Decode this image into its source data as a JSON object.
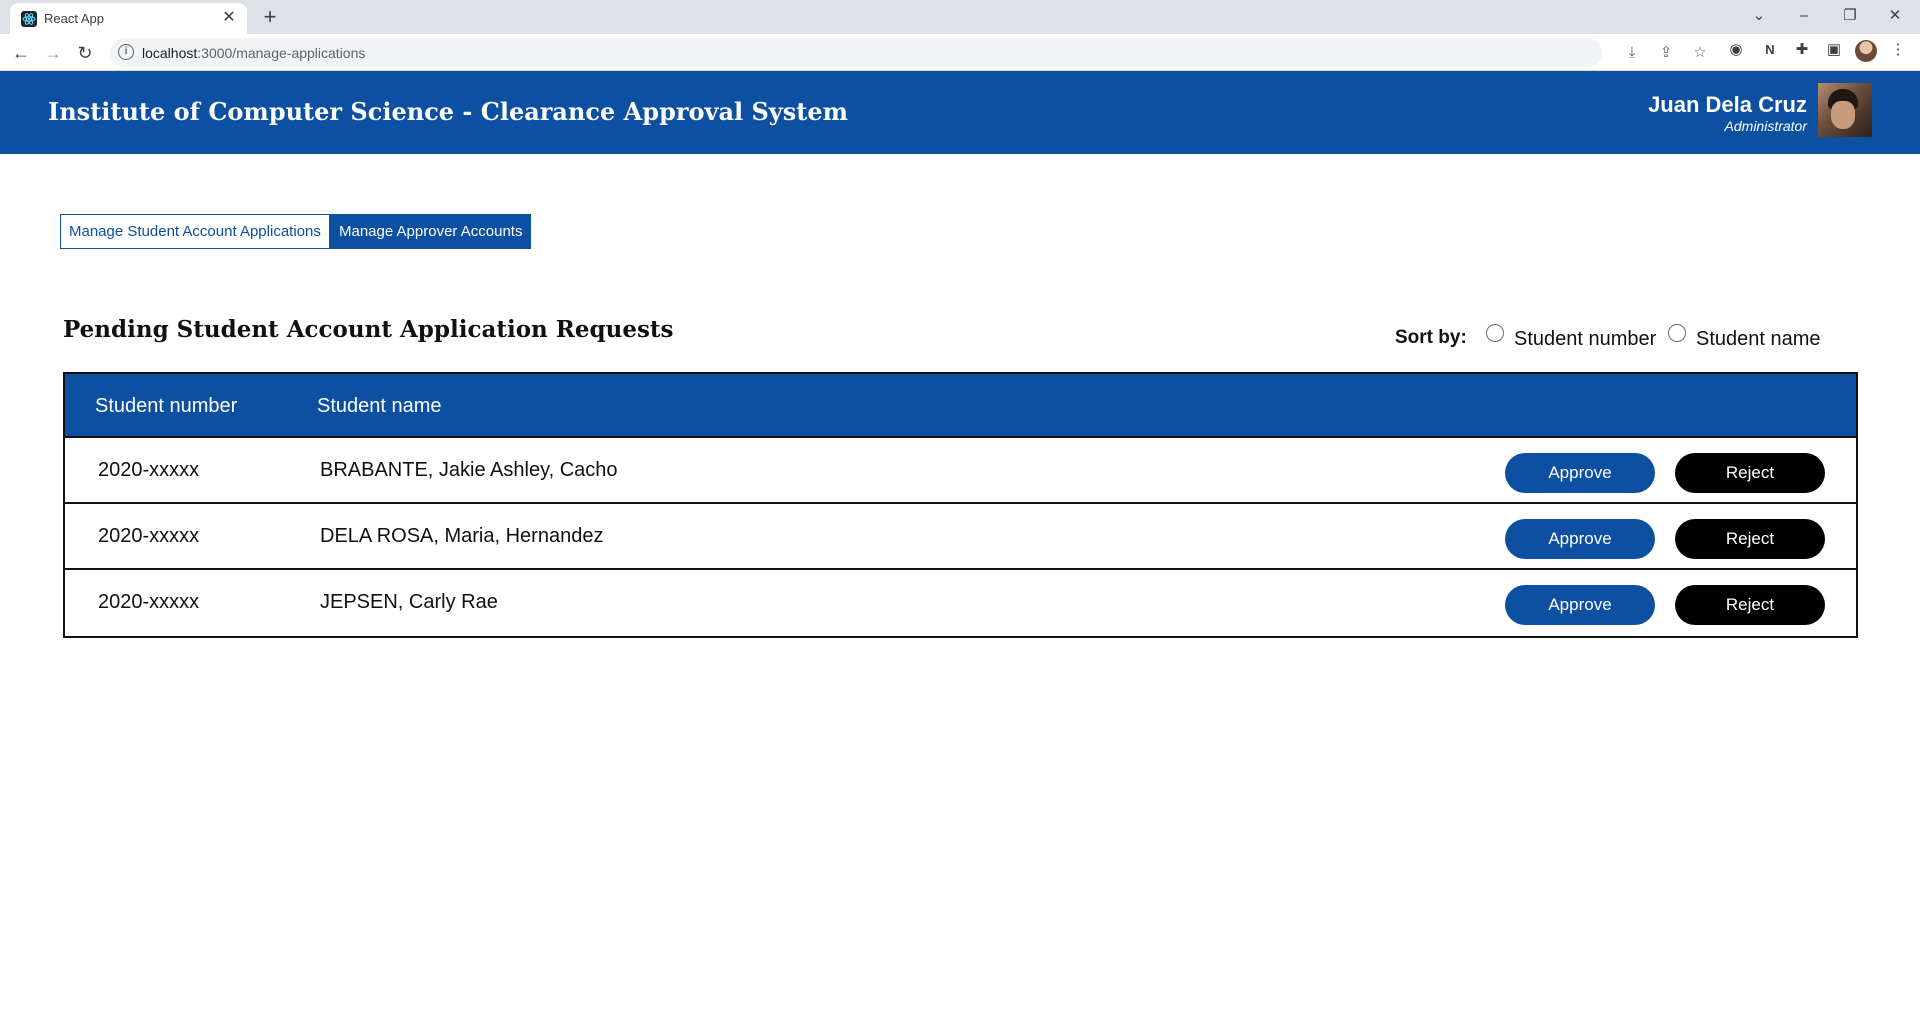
{
  "browser": {
    "tab_title": "React App",
    "tab_close": "✕",
    "new_tab": "+",
    "url_host": "localhost",
    "url_path": ":3000/manage-applications"
  },
  "header": {
    "title": "Institute of Computer Science - Clearance Approval System",
    "user_name": "Juan Dela Cruz",
    "user_role": "Administrator"
  },
  "nav": {
    "student_apps_label": "Manage Student Account Applications",
    "approver_accounts_label": "Manage Approver Accounts"
  },
  "section": {
    "title": "Pending Student Account Application Requests",
    "sort_label": "Sort by:",
    "sort_options": [
      "Student number",
      "Student name"
    ]
  },
  "table": {
    "headers": [
      "Student number",
      "Student name"
    ],
    "rows": [
      {
        "student_number": "2020-xxxxx",
        "student_name": "BRABANTE, Jakie Ashley, Cacho"
      },
      {
        "student_number": "2020-xxxxx",
        "student_name": "DELA ROSA, Maria, Hernandez"
      },
      {
        "student_number": "2020-xxxxx",
        "student_name": "JEPSEN, Carly Rae"
      }
    ],
    "approve_label": "Approve",
    "reject_label": "Reject"
  },
  "colors": {
    "brand_blue": "#0d4fa0",
    "reject_black": "#000000"
  }
}
